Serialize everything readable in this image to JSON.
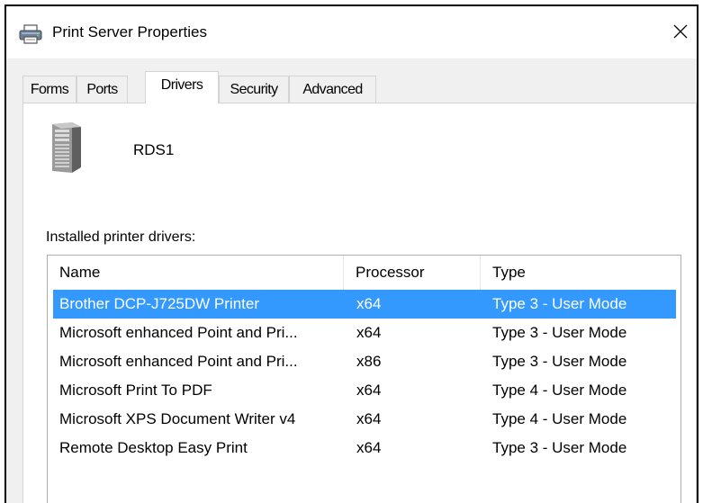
{
  "window": {
    "title": "Print Server Properties",
    "close_glyph": "✕"
  },
  "tabs": [
    {
      "label": "Forms",
      "active": false
    },
    {
      "label": "Ports",
      "active": false
    },
    {
      "label": "Drivers",
      "active": true
    },
    {
      "label": "Security",
      "active": false
    },
    {
      "label": "Advanced",
      "active": false
    }
  ],
  "server": {
    "name": "RDS1",
    "icon": "server-tower-icon"
  },
  "drivers_label": "Installed printer drivers:",
  "table": {
    "columns": [
      "Name",
      "Processor",
      "Type"
    ],
    "rows": [
      {
        "name": "Brother DCP-J725DW Printer",
        "processor": "x64",
        "type": "Type 3 - User Mode",
        "selected": true
      },
      {
        "name": "Microsoft enhanced Point and Pri...",
        "processor": "x64",
        "type": "Type 3 - User Mode",
        "selected": false
      },
      {
        "name": "Microsoft enhanced Point and Pri...",
        "processor": "x86",
        "type": "Type 3 - User Mode",
        "selected": false
      },
      {
        "name": "Microsoft Print To PDF",
        "processor": "x64",
        "type": "Type 4 - User Mode",
        "selected": false
      },
      {
        "name": "Microsoft XPS Document Writer v4",
        "processor": "x64",
        "type": "Type 4 - User Mode",
        "selected": false
      },
      {
        "name": "Remote Desktop Easy Print",
        "processor": "x64",
        "type": "Type 3 - User Mode",
        "selected": false
      }
    ]
  },
  "colors": {
    "selection": "#3399ff",
    "selection_text": "#ffffff"
  }
}
